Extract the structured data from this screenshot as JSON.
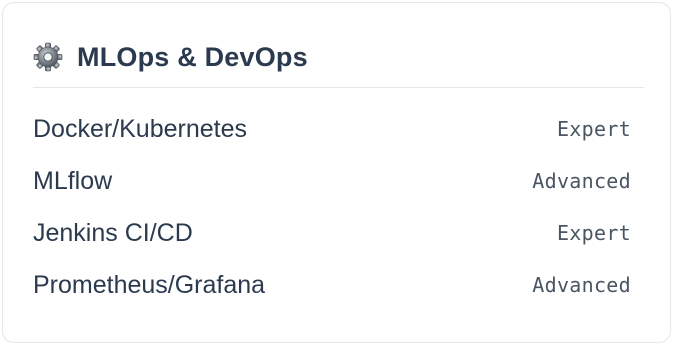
{
  "card": {
    "icon": "gear-icon",
    "title": "MLOps & DevOps"
  },
  "skills": [
    {
      "name": "Docker/Kubernetes",
      "level": "Expert"
    },
    {
      "name": "MLflow",
      "level": "Advanced"
    },
    {
      "name": "Jenkins CI/CD",
      "level": "Expert"
    },
    {
      "name": "Prometheus/Grafana",
      "level": "Advanced"
    }
  ],
  "colors": {
    "text": "#2b3a4e",
    "muted": "#4a5564",
    "border": "#e3e6ea"
  }
}
